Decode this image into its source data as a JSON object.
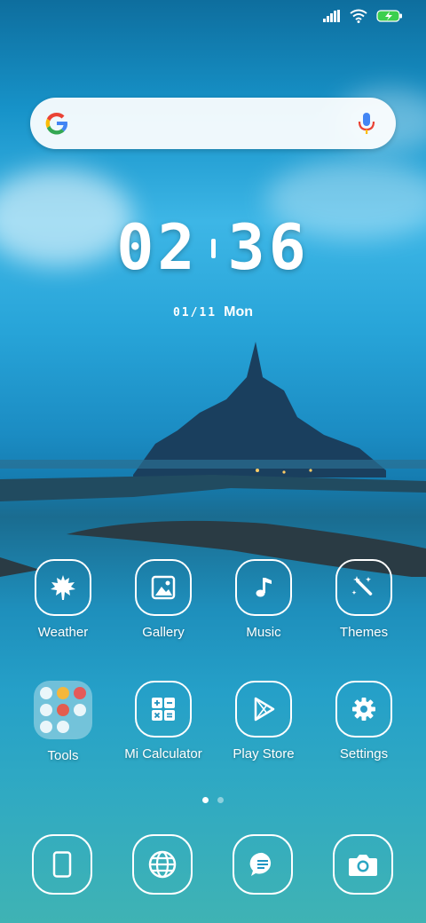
{
  "status_bar": {
    "icons": [
      "signal-icon",
      "wifi-icon",
      "battery-charging-icon"
    ],
    "battery_color": "#3ccf4e"
  },
  "search_bar": {
    "left_icon": "google-g-icon",
    "right_icon": "microphone-icon"
  },
  "clock": {
    "hours": "02",
    "minutes": "36"
  },
  "date": {
    "day": "01/11",
    "weekday": "Mon"
  },
  "apps": [
    {
      "label": "Weather",
      "icon": "maple-leaf-icon"
    },
    {
      "label": "Gallery",
      "icon": "image-icon"
    },
    {
      "label": "Music",
      "icon": "music-note-icon"
    },
    {
      "label": "Themes",
      "icon": "magic-wand-icon"
    },
    {
      "label": "Tools",
      "icon": "folder-icon"
    },
    {
      "label": "Mi Calculator",
      "icon": "calculator-icon"
    },
    {
      "label": "Play Store",
      "icon": "play-store-icon"
    },
    {
      "label": "Settings",
      "icon": "gear-icon"
    }
  ],
  "page_indicator": {
    "pages": 2,
    "active": 1
  },
  "dock": [
    {
      "icon": "phone-icon"
    },
    {
      "icon": "globe-icon"
    },
    {
      "icon": "message-icon"
    },
    {
      "icon": "camera-icon"
    }
  ]
}
